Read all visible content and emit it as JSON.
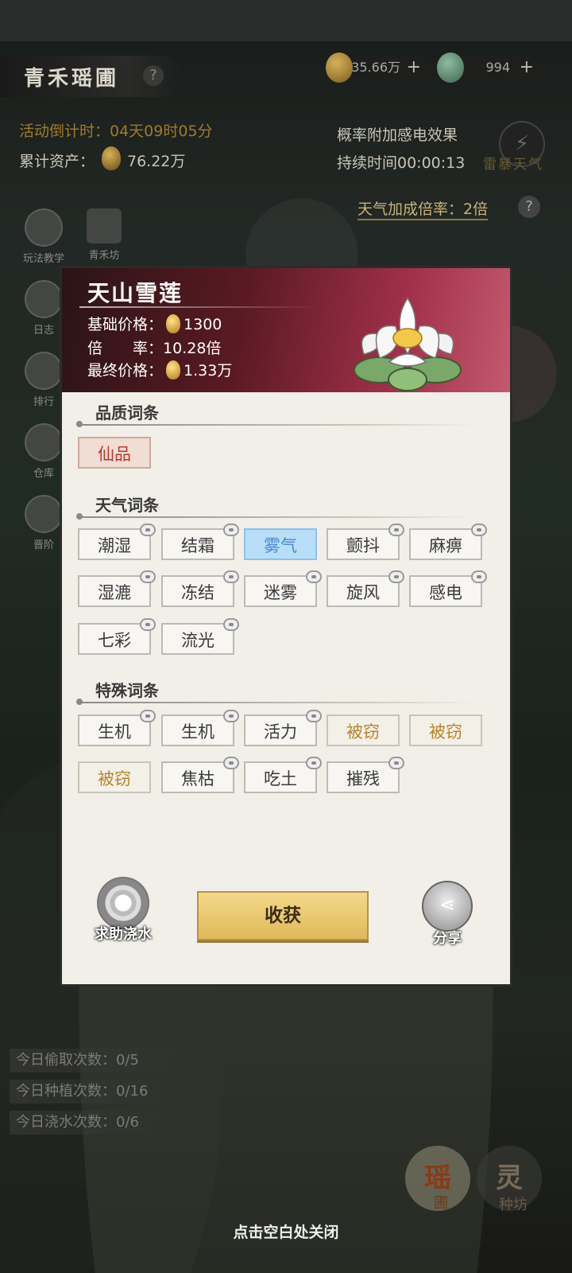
{
  "header": {
    "title": "青禾瑶圃",
    "help": "?",
    "resource1": "35.66万",
    "resource2": "994",
    "plus": "+"
  },
  "activity": {
    "countdown": "活动倒计时：04天09时05分",
    "assets_label": "累计资产：",
    "assets_value": "76.22万",
    "effect": "概率附加感电效果",
    "duration": "持续时间00:00:13",
    "weather_name": "雷暴天气",
    "multiplier": "天气加成倍率：2倍"
  },
  "side": {
    "tutorial": "玩法教学",
    "shop": "青禾坊",
    "log": "日志",
    "rank": "排行",
    "warehouse": "仓库",
    "upgrade": "晋阶"
  },
  "stats": [
    "今日偷取次数：0/5",
    "今日种植次数：0/16",
    "今日浇水次数：0/6"
  ],
  "bottom": {
    "yao": "瑶",
    "yao2": "圃",
    "ling": "灵",
    "ling2": "种坊",
    "close_hint": "点击空白处关闭"
  },
  "panel": {
    "name": "天山雪莲",
    "base_label": "基础价格：",
    "base_value": "1300",
    "rate_label": "倍　　率：",
    "rate_value": "10.28倍",
    "final_label": "最终价格：",
    "final_value": "1.33万",
    "quality_title": "品质词条",
    "quality": [
      "仙品"
    ],
    "weather_title": "天气词条",
    "weather": [
      "潮湿",
      "结霜",
      "雾气",
      "颤抖",
      "麻痹",
      "湿漉",
      "冻结",
      "迷雾",
      "旋风",
      "感电",
      "七彩",
      "流光"
    ],
    "special_title": "特殊词条",
    "special": [
      "生机",
      "生机",
      "活力",
      "被窃",
      "被窃",
      "被窃",
      "焦枯",
      "吃土",
      "摧残"
    ],
    "help_water": "求助浇水",
    "harvest": "收获",
    "share": "分享"
  }
}
